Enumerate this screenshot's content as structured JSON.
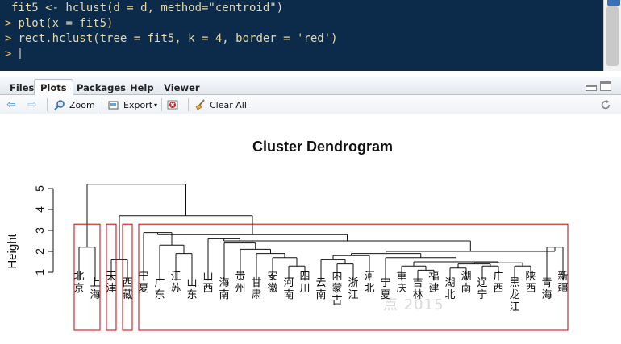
{
  "console": {
    "lines": [
      {
        "prompt": "",
        "text": "fit5 <- hclust(d = d, method=\"centroid\")"
      },
      {
        "prompt": ">",
        "text": "plot(x = fit5)"
      },
      {
        "prompt": ">",
        "text": "rect.hclust(tree = fit5, k = 4, border = 'red')"
      },
      {
        "prompt": ">",
        "text": ""
      }
    ]
  },
  "tabs": [
    {
      "label": "Files",
      "active": false
    },
    {
      "label": "Plots",
      "active": true
    },
    {
      "label": "Packages",
      "active": false
    },
    {
      "label": "Help",
      "active": false
    },
    {
      "label": "Viewer",
      "active": false
    }
  ],
  "toolbar": {
    "zoom_label": "Zoom",
    "export_label": "Export",
    "clear_all_label": "Clear All"
  },
  "icons": {
    "back": "back-arrow-icon",
    "forward": "forward-arrow-icon",
    "zoom": "magnifier-icon",
    "export": "export-icon",
    "remove": "remove-plot-icon",
    "clear": "broom-icon",
    "refresh": "refresh-icon"
  },
  "colors": {
    "console_bg": "#0c2a4a",
    "console_text": "#e6d9a8",
    "rect_border": "#cc0000"
  },
  "chart_data": {
    "type": "dendrogram",
    "title": "Cluster Dendrogram",
    "ylabel": "Height",
    "yticks": [
      1,
      2,
      3,
      4,
      5
    ],
    "ylim": [
      0.8,
      5.5
    ],
    "rect_k": 4,
    "rect_border": "red",
    "leaves": [
      "北京",
      "上海",
      "天津",
      "西藏",
      "宁夏",
      "广东",
      "江苏",
      "山东",
      "山西",
      "海南",
      "贵州",
      "甘肃",
      "安徽",
      "河南",
      "四川",
      "云南",
      "内蒙古",
      "浙江",
      "河北",
      "宁夏",
      "重庆",
      "吉林",
      "福建",
      "湖北",
      "湖南",
      "辽宁",
      "广西",
      "黑龙江",
      "陕西",
      "青海",
      "新疆"
    ],
    "merges": [
      {
        "height": 5.2,
        "note": "root"
      },
      {
        "height": 3.7
      },
      {
        "height": 3.3
      },
      {
        "height": 2.9
      },
      {
        "height": 2.7
      },
      {
        "height": 2.5
      },
      {
        "height": 2.3
      },
      {
        "height": 2.1
      },
      {
        "height": 1.9
      },
      {
        "height": 1.7
      },
      {
        "height": 1.5
      },
      {
        "height": 1.3
      },
      {
        "height": 1.1
      }
    ]
  },
  "watermark": "点 2015"
}
